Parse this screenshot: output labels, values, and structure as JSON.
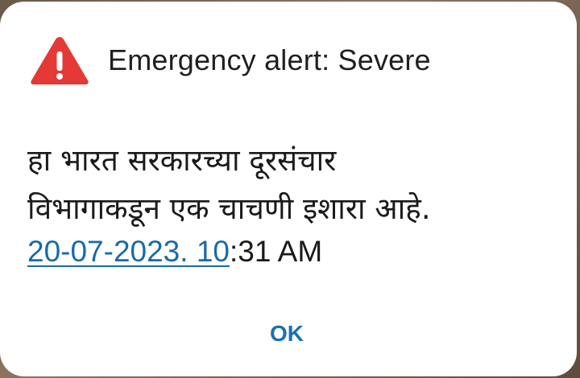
{
  "alert": {
    "title": "Emergency alert: Severe",
    "icon": "warning-triangle-icon",
    "icon_color": "#e53935",
    "message_lines": [
      "हा भारत सरकारच्या दूरसंचार",
      "विभागाकडून एक चाचणी इशारा आहे."
    ],
    "timestamp_link": "20-07-2023. 10",
    "timestamp_rest": ":31 AM",
    "link_color": "#1a6aa8",
    "ok_label": "OK",
    "button_color": "#1b6fb3"
  }
}
